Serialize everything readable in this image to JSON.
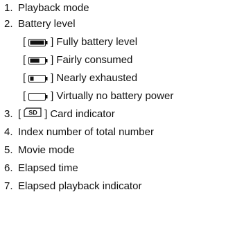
{
  "items": [
    {
      "number": "1.",
      "label": "Playback mode"
    },
    {
      "number": "2.",
      "label": "Battery level"
    },
    {
      "number": "3.",
      "label": "Card indicator",
      "icon": "sd-card-icon",
      "icon_text": "SD"
    },
    {
      "number": "4.",
      "label": "Index number of total number"
    },
    {
      "number": "5.",
      "label": "Movie mode"
    },
    {
      "number": "6.",
      "label": "Elapsed time"
    },
    {
      "number": "7.",
      "label": "Elapsed playback indicator"
    }
  ],
  "battery_levels": [
    {
      "label": "Fully battery level",
      "icon": "battery-full-icon",
      "fill": 1.0
    },
    {
      "label": "Fairly consumed",
      "icon": "battery-two-thirds-icon",
      "fill": 0.66
    },
    {
      "label": "Nearly exhausted",
      "icon": "battery-low-icon",
      "fill": 0.25
    },
    {
      "label": "Virtually no battery power",
      "icon": "battery-empty-icon",
      "fill": 0.0
    }
  ],
  "brackets": {
    "open": "[",
    "close": "]"
  }
}
